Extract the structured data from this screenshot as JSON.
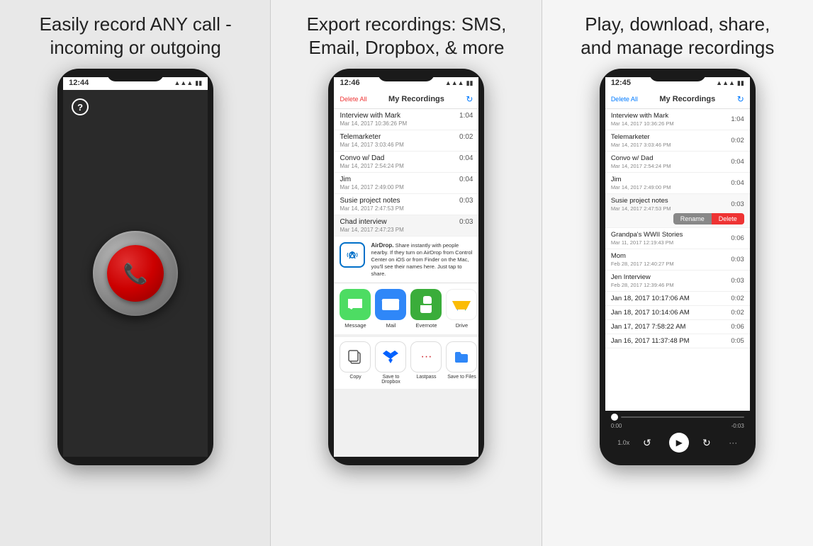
{
  "panel1": {
    "headline": "Easily record ANY call - incoming or outgoing",
    "status_time": "12:44",
    "wifi": "▲▲▲",
    "battery": "▮▮▮",
    "help_label": "?"
  },
  "panel2": {
    "headline": "Export recordings: SMS, Email, Dropbox, & more",
    "status_time": "12:46",
    "nav": {
      "delete_all": "Delete All",
      "title": "My Recordings",
      "refresh": "↻"
    },
    "recordings": [
      {
        "name": "Interview with Mark",
        "date": "Mar 14, 2017 10:36:26 PM",
        "duration": "1:04"
      },
      {
        "name": "Telemarketer",
        "date": "Mar 14, 2017 3:03:46 PM",
        "duration": "0:02"
      },
      {
        "name": "Convo w/ Dad",
        "date": "Mar 14, 2017 2:54:24 PM",
        "duration": "0:04"
      },
      {
        "name": "Jim",
        "date": "Mar 14, 2017 2:49:00 PM",
        "duration": "0:04"
      },
      {
        "name": "Susie project notes",
        "date": "Mar 14, 2017 2:47:53 PM",
        "duration": "0:03"
      },
      {
        "name": "Chad interview",
        "date": "Mar 14, 2017 2:47:23 PM",
        "duration": "0:03"
      }
    ],
    "airdrop": {
      "title": "AirDrop.",
      "desc": "Share instantly with people nearby. If they turn on AirDrop from Control Center on iOS or from Finder on the Mac, you'll see their names here. Just tap to share."
    },
    "apps": [
      {
        "name": "Message",
        "color": "#4ddc63",
        "icon": "💬"
      },
      {
        "name": "Mail",
        "color": "#2f87f8",
        "icon": "✉️"
      },
      {
        "name": "Evernote",
        "color": "#3aad3a",
        "icon": "🐘"
      },
      {
        "name": "Drive",
        "color": "#white",
        "icon": "△"
      }
    ],
    "actions": [
      {
        "name": "Copy",
        "icon": "⧉"
      },
      {
        "name": "Save to Dropbox",
        "icon": "📦"
      },
      {
        "name": "Lastpass",
        "icon": "···"
      },
      {
        "name": "Save to Files",
        "icon": "📁"
      }
    ]
  },
  "panel3": {
    "headline": "Play, download, share, and manage recordings",
    "status_time": "12:45",
    "nav": {
      "delete_all": "Delete All",
      "title": "My Recordings",
      "refresh": "↻"
    },
    "recordings": [
      {
        "name": "Interview with Mark",
        "date": "Mar 14, 2017 10:36:26 PM",
        "duration": "1:04"
      },
      {
        "name": "Telemarketer",
        "date": "Mar 14, 2017 3:03:46 PM",
        "duration": "0:02"
      },
      {
        "name": "Convo w/ Dad",
        "date": "Mar 14, 2017 2:54:24 PM",
        "duration": "0:04"
      },
      {
        "name": "Jim",
        "date": "Mar 14, 2017 2:49:00 PM",
        "duration": "0:04"
      },
      {
        "name": "Susie project notes",
        "date": "Mar 14, 2017 2:47:53 PM",
        "duration": "0:03",
        "expanded": true,
        "btn_rename": "Rename",
        "btn_delete": "Delete"
      },
      {
        "name": "Grandpa's WWII Stories",
        "date": "Mar 11, 2017 12:19:43 PM",
        "duration": "0:06"
      },
      {
        "name": "Mom",
        "date": "Feb 28, 2017 12:40:27 PM",
        "duration": "0:03"
      },
      {
        "name": "Jen Interview",
        "date": "Feb 28, 2017 12:39:46 PM",
        "duration": "0:03"
      },
      {
        "name": "Jan 18, 2017 10:17:06 AM",
        "date": "",
        "duration": "0:02"
      },
      {
        "name": "Jan 18, 2017 10:14:06 AM",
        "date": "",
        "duration": "0:02"
      },
      {
        "name": "Jan 17, 2017 7:58:22 AM",
        "date": "",
        "duration": "0:06"
      },
      {
        "name": "Jan 16, 2017 11:37:48 PM",
        "date": "",
        "duration": "0:05"
      }
    ],
    "player": {
      "time_start": "0:00",
      "time_end": "-0:03",
      "speed": "1.0x",
      "play_icon": "▶"
    }
  }
}
